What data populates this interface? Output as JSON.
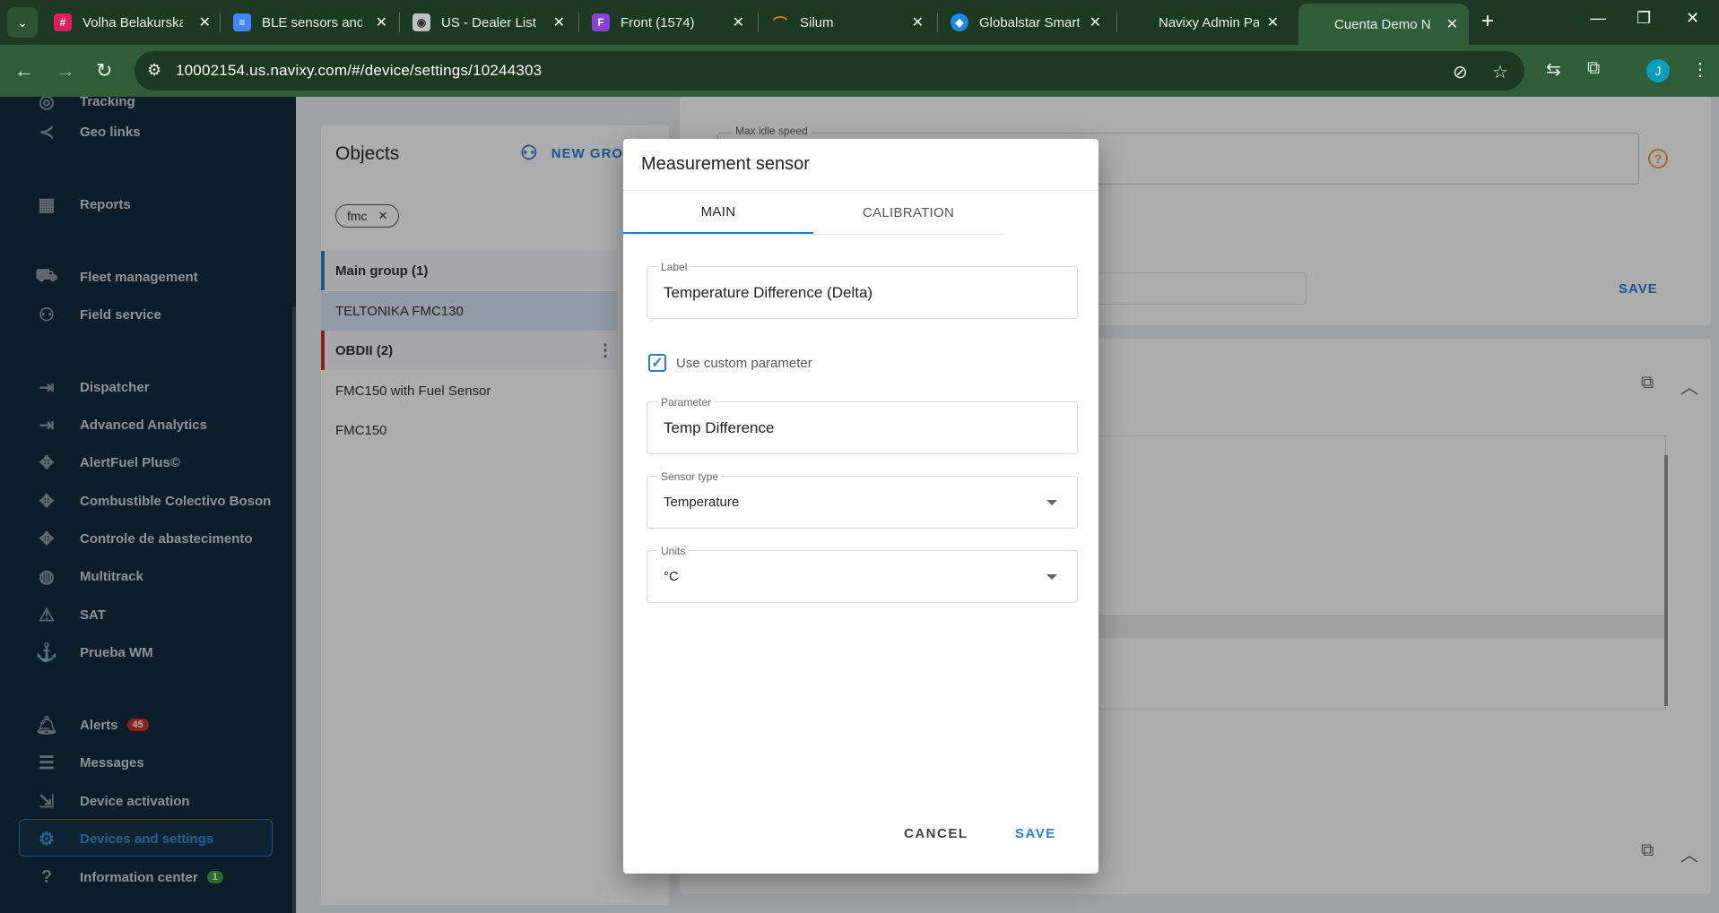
{
  "browser": {
    "tabs": [
      {
        "title": "Volha Belakurska",
        "icon": "slack-icon",
        "color": "#e01e5a"
      },
      {
        "title": "BLE sensors and",
        "icon": "docs-icon",
        "color": "#4285f4"
      },
      {
        "title": "US - Dealer List",
        "icon": "stack-icon",
        "color": "#c0c0c0"
      },
      {
        "title": "Front (1574)",
        "icon": "front-icon",
        "color": "#8b3fd9"
      },
      {
        "title": "Silum",
        "icon": "silum-icon",
        "color": "#e07b2a"
      },
      {
        "title": "Globalstar Smart",
        "icon": "globalstar-icon",
        "color": "#1e88e5"
      },
      {
        "title": "Navixy Admin Pa",
        "icon": "navixy-icon",
        "color": "#2e5d38"
      },
      {
        "title": "Cuenta Demo N",
        "icon": "navixy-icon",
        "color": "#2e5d38"
      }
    ],
    "url": "10002154.us.navixy.com/#/device/settings/10244303",
    "profile_initial": "J"
  },
  "sidebar": {
    "items": [
      {
        "label": "Tracking",
        "icon": "tracking-icon"
      },
      {
        "label": "Geo links",
        "icon": "share-icon"
      },
      {
        "label": "Reports",
        "icon": "reports-icon"
      },
      {
        "label": "Fleet management",
        "icon": "car-icon"
      },
      {
        "label": "Field service",
        "icon": "people-icon"
      },
      {
        "label": "Dispatcher",
        "icon": "login-icon"
      },
      {
        "label": "Advanced Analytics",
        "icon": "login-icon"
      },
      {
        "label": "AlertFuel Plus©",
        "icon": "puzzle-icon"
      },
      {
        "label": "Combustible Colectivo Boson",
        "icon": "puzzle-icon"
      },
      {
        "label": "Controle de abastecimento",
        "icon": "puzzle-icon"
      },
      {
        "label": "Multitrack",
        "icon": "multitrack-icon"
      },
      {
        "label": "SAT",
        "icon": "alert-box-icon"
      },
      {
        "label": "Prueba WM",
        "icon": "anchor-icon"
      },
      {
        "label": "Alerts",
        "icon": "bell-icon",
        "badge": "45"
      },
      {
        "label": "Messages",
        "icon": "chat-icon"
      },
      {
        "label": "Device activation",
        "icon": "device-activation-icon"
      },
      {
        "label": "Devices and settings",
        "icon": "gear-icon"
      },
      {
        "label": "Information center",
        "icon": "help-circle-icon",
        "badge": "1"
      }
    ]
  },
  "objects_panel": {
    "title": "Objects",
    "new_group": "NEW GRO",
    "filter_chip": "fmc",
    "rows": [
      {
        "label": "Main group  (1)",
        "kind": "group"
      },
      {
        "label": "TELTONIKA FMC130",
        "kind": "selected"
      },
      {
        "label": "OBDII  (2)",
        "kind": "group"
      },
      {
        "label": "FMC150 with Fuel Sensor",
        "kind": "item"
      },
      {
        "label": "FMC150",
        "kind": "item"
      }
    ]
  },
  "settings_bg": {
    "max_idle_label": "Max idle speed",
    "save": "SAVE"
  },
  "dialog": {
    "title": "Measurement sensor",
    "tabs": [
      "MAIN",
      "CALIBRATION"
    ],
    "label_field": {
      "label": "Label",
      "value": "Temperature Difference (Delta)"
    },
    "custom_param_checkbox": {
      "label": "Use custom parameter",
      "checked": true
    },
    "parameter_field": {
      "label": "Parameter",
      "value": "Temp Difference"
    },
    "sensor_type": {
      "label": "Sensor type",
      "value": "Temperature"
    },
    "units": {
      "label": "Units",
      "value": "°C"
    },
    "cancel": "CANCEL",
    "save": "SAVE"
  }
}
